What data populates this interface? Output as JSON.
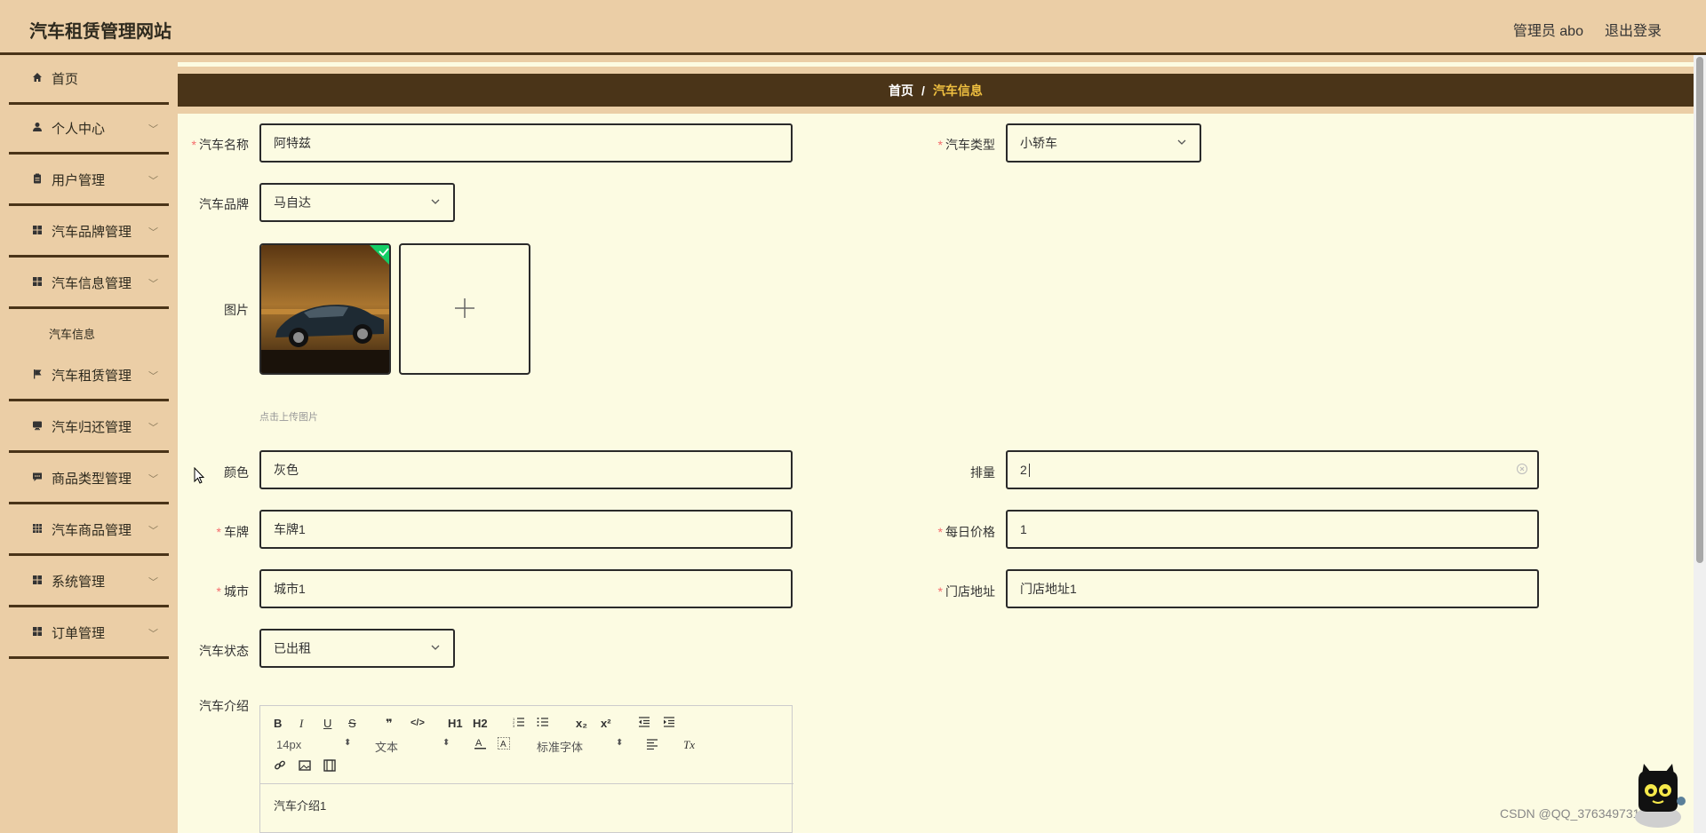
{
  "header": {
    "title": "汽车租赁管理网站",
    "user": "管理员 abo",
    "logout": "退出登录"
  },
  "sidebar": {
    "items": [
      {
        "label": "首页",
        "icon": "home-icon"
      },
      {
        "label": "个人中心",
        "icon": "user-icon"
      },
      {
        "label": "用户管理",
        "icon": "clipboard-icon"
      },
      {
        "label": "汽车品牌管理",
        "icon": "grid-icon"
      },
      {
        "label": "汽车信息管理",
        "icon": "grid-icon"
      },
      {
        "label": "汽车租赁管理",
        "icon": "flag-icon"
      },
      {
        "label": "汽车归还管理",
        "icon": "monitor-icon"
      },
      {
        "label": "商品类型管理",
        "icon": "chat-icon"
      },
      {
        "label": "汽车商品管理",
        "icon": "apps-icon"
      },
      {
        "label": "系统管理",
        "icon": "grid-icon"
      },
      {
        "label": "订单管理",
        "icon": "grid-icon"
      }
    ],
    "subitem": "汽车信息"
  },
  "breadcrumb": {
    "home": "首页",
    "separator": "/",
    "current": "汽车信息"
  },
  "form": {
    "car_name": {
      "label": "汽车名称",
      "value": "阿特兹"
    },
    "car_type": {
      "label": "汽车类型",
      "value": "小轿车"
    },
    "car_brand": {
      "label": "汽车品牌",
      "value": "马自达"
    },
    "image": {
      "label": "图片",
      "tip": "点击上传图片"
    },
    "color": {
      "label": "颜色",
      "value": "灰色"
    },
    "displacement": {
      "label": "排量",
      "value": "2"
    },
    "plate": {
      "label": "车牌",
      "value": "车牌1"
    },
    "daily_price": {
      "label": "每日价格",
      "value": "1"
    },
    "city": {
      "label": "城市",
      "value": "城市1"
    },
    "store_address": {
      "label": "门店地址",
      "value": "门店地址1"
    },
    "status": {
      "label": "汽车状态",
      "value": "已出租"
    },
    "intro": {
      "label": "汽车介绍",
      "value": "汽车介绍1"
    }
  },
  "editor": {
    "font_size": "14px",
    "text_type": "文本",
    "font_family": "标准字体",
    "bold": "B",
    "italic": "I",
    "underline": "U",
    "strike": "S",
    "quote": "❞",
    "code": "</>",
    "h1": "H1",
    "h2": "H2",
    "sub": "x₂",
    "sup": "x²",
    "clear": "Tx"
  },
  "watermark": "CSDN @QQ_3763497310"
}
